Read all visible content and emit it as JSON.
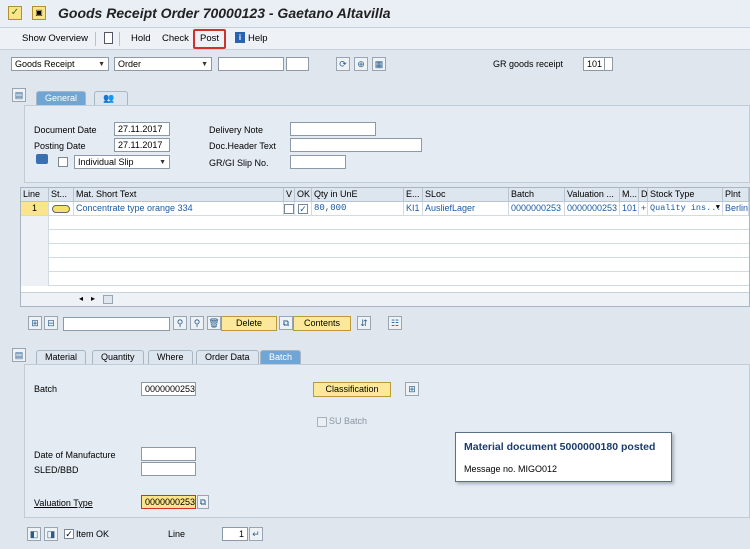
{
  "window": {
    "title": "Goods Receipt Order 70000123 - Gaetano Altavilla"
  },
  "toolbar": {
    "show_overview": "Show Overview",
    "hold": "Hold",
    "check": "Check",
    "post": "Post",
    "help": "Help"
  },
  "header": {
    "action_select": "Goods Receipt",
    "reference_select": "Order",
    "gr_label": "GR goods receipt",
    "movement_type": "101"
  },
  "general_tabs": [
    "General"
  ],
  "general": {
    "document_date_label": "Document Date",
    "document_date": "27.11.2017",
    "posting_date_label": "Posting Date",
    "posting_date": "27.11.2017",
    "delivery_note_label": "Delivery Note",
    "doc_header_text_label": "Doc.Header Text",
    "gr_gi_slip_label": "GR/GI Slip No.",
    "slip_select": "Individual Slip"
  },
  "items_table": {
    "headers": [
      "Line",
      "St...",
      "Mat. Short Text",
      "V",
      "OK",
      "Qty in UnE",
      "E...",
      "SLoc",
      "Batch",
      "Valuation ...",
      "M...",
      "D",
      "Stock Type",
      "Plnt"
    ],
    "row": {
      "line": "1",
      "mat_short_text": "Concentrate type orange 334",
      "qty": "80,000",
      "unit": "KI1",
      "sloc": "AusliefLager",
      "batch": "0000000253",
      "valuation": "0000000253",
      "movement": "101",
      "d": "+",
      "stock_type": "Quality ins...",
      "plant": "Berlin"
    }
  },
  "item_toolbar": {
    "delete": "Delete",
    "contents": "Contents"
  },
  "detail_tabs": [
    "Material",
    "Quantity",
    "Where",
    "Order Data",
    "Batch"
  ],
  "batch": {
    "batch_label": "Batch",
    "batch_value": "0000000253",
    "classification": "Classification",
    "su_batch": "SU Batch",
    "date_of_manufacture_label": "Date of Manufacture",
    "sled_label": "SLED/BBD",
    "valuation_type_label": "Valuation Type",
    "valuation_type_value": "0000000253"
  },
  "message": {
    "title": "Material document 5000000180 posted",
    "text": "Message no. MIGO012"
  },
  "footer": {
    "item_ok": "Item OK",
    "line_label": "Line",
    "line_value": "1"
  },
  "colors": {
    "post_highlight": "#d0312d",
    "active_tab": "#6fa6d6"
  }
}
